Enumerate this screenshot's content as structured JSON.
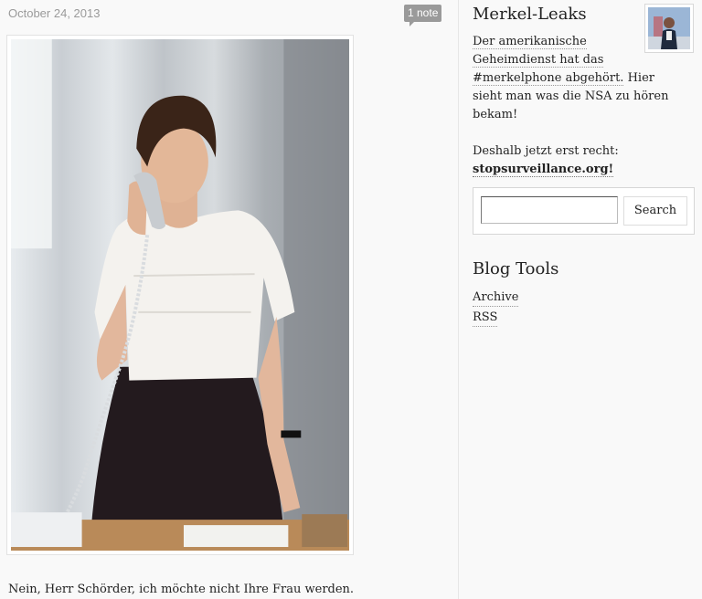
{
  "post": {
    "date": "October 24, 2013",
    "notes": "1 note",
    "caption": "Nein, Herr Schörder, ich möchte nicht Ihre Frau werden."
  },
  "sidebar": {
    "blog_title": "Merkel-Leaks",
    "description": {
      "line1": "Der amerikanische",
      "line2": "Geheimdienst hat das",
      "hashtag": "#merkelphone abgehört.",
      "rest": " Hier sieht man was die NSA zu hören bekam!",
      "line3": "Deshalb jetzt erst recht:",
      "link": "stopsurveillance.org!"
    },
    "search": {
      "button_label": "Search",
      "placeholder": ""
    },
    "tools": {
      "title": "Blog Tools",
      "items": [
        "Archive",
        "RSS"
      ]
    }
  },
  "colors": {
    "meta_gray": "#9a9a9a",
    "background": "#f9f9f9"
  }
}
